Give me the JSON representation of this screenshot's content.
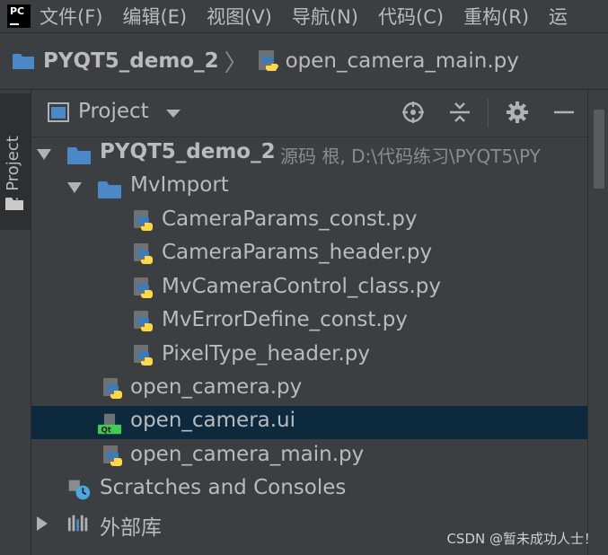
{
  "app": {
    "logo_text": "PC"
  },
  "menu": {
    "items": [
      "文件(F)",
      "编辑(E)",
      "视图(V)",
      "导航(N)",
      "代码(C)",
      "重构(R)",
      "运"
    ]
  },
  "breadcrumb": {
    "project": "PYQT5_demo_2",
    "separator": "〉",
    "file": "open_camera_main.py"
  },
  "sidebar": {
    "tab_label": "1: Project"
  },
  "panel": {
    "title": "Project"
  },
  "tree": {
    "root": {
      "label": "PYQT5_demo_2",
      "hint": "源码 根,  D:\\代码练习\\PYQT5\\PY"
    },
    "folder": {
      "label": "MvImport"
    },
    "folder_files": [
      "CameraParams_const.py",
      "CameraParams_header.py",
      "MvCameraControl_class.py",
      "MvErrorDefine_const.py",
      "PixelType_header.py"
    ],
    "root_files": [
      "open_camera.py",
      "open_camera.ui",
      "open_camera_main.py"
    ],
    "scratches": "Scratches and Consoles",
    "external": "外部库"
  },
  "watermark": "CSDN @暂未成功人士！",
  "colors": {
    "background": "#3c3f41",
    "selection": "#0d293e",
    "text": "#bbbbbb",
    "folder": "#4a88c7",
    "python_blue": "#3d7ab8",
    "python_yellow": "#ffd845",
    "qt_green": "#41cd52"
  }
}
